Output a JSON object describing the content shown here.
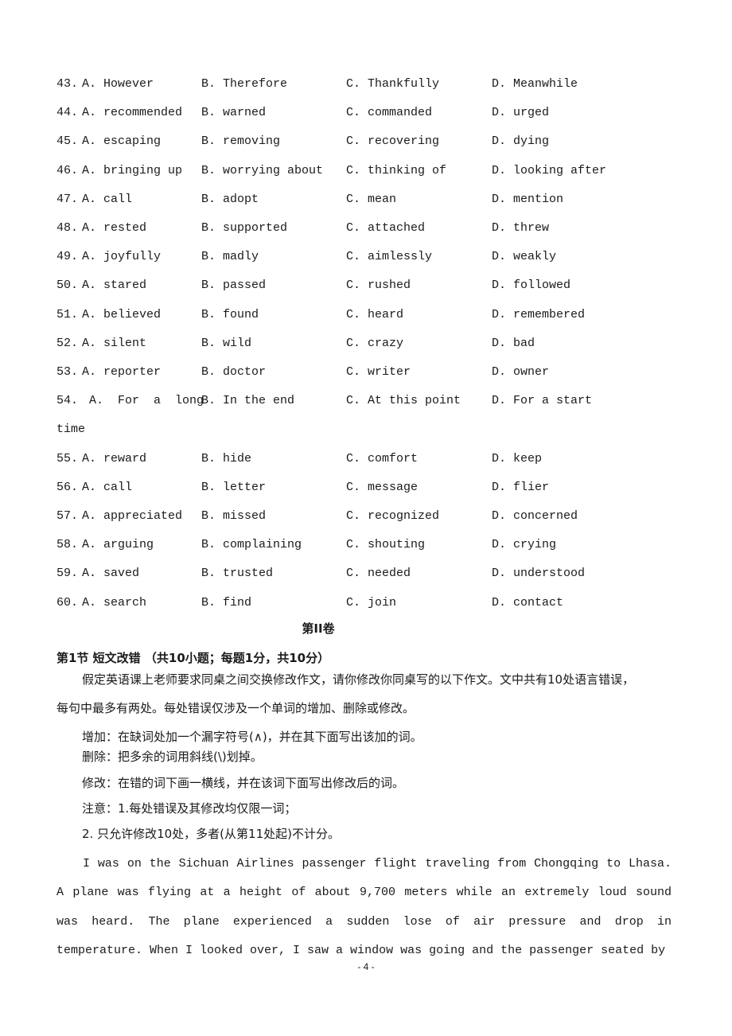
{
  "questions": [
    {
      "num": "43.",
      "a": "A. However",
      "b": "B. Therefore",
      "c": "C. Thankfully",
      "d": "D. Meanwhile"
    },
    {
      "num": "44.",
      "a": "A. recommended",
      "b": "B. warned",
      "c": "C. commanded",
      "d": "D. urged"
    },
    {
      "num": "45.",
      "a": "A. escaping",
      "b": "B. removing",
      "c": "C. recovering",
      "d": "D. dying"
    },
    {
      "num": "46.",
      "a": "A. bringing up",
      "b": "B. worrying about",
      "c": "C. thinking of",
      "d": "D. looking after"
    },
    {
      "num": "47.",
      "a": "A. call",
      "b": "B. adopt",
      "c": "C. mean",
      "d": "D. mention"
    },
    {
      "num": "48.",
      "a": "A. rested",
      "b": "B. supported",
      "c": "C. attached",
      "d": "D. threw"
    },
    {
      "num": "49.",
      "a": "A. joyfully",
      "b": "B. madly",
      "c": "C. aimlessly",
      "d": "D. weakly"
    },
    {
      "num": "50.",
      "a": "A. stared",
      "b": "B. passed",
      "c": "C. rushed",
      "d": "D. followed"
    },
    {
      "num": "51.",
      "a": "A. believed",
      "b": "B. found",
      "c": "C. heard",
      "d": "D. remembered"
    },
    {
      "num": "52.",
      "a": "A. silent",
      "b": "B. wild",
      "c": "C. crazy",
      "d": "D. bad"
    },
    {
      "num": "53.",
      "a": "A. reporter",
      "b": "B. doctor",
      "c": "C. writer",
      "d": "D. owner"
    },
    {
      "num": "54.",
      "a": " A.  For  a  long",
      "b": "B. In the end",
      "c": "C. At this point",
      "d": "D. For a start",
      "wrap": "time"
    },
    {
      "num": "55.",
      "a": "A. reward",
      "b": "B. hide",
      "c": "C. comfort",
      "d": "D. keep"
    },
    {
      "num": "56.",
      "a": "A. call",
      "b": "B. letter",
      "c": "C. message",
      "d": "D. flier"
    },
    {
      "num": "57.",
      "a": "A. appreciated",
      "b": "B. missed",
      "c": "C. recognized",
      "d": "D. concerned"
    },
    {
      "num": "58.",
      "a": "A. arguing",
      "b": "B. complaining",
      "c": "C. shouting",
      "d": "D. crying"
    },
    {
      "num": "59.",
      "a": "A. saved",
      "b": "B. trusted",
      "c": "C. needed",
      "d": "D. understood"
    },
    {
      "num": "60.",
      "a": "A. search",
      "b": "B. find",
      "c": "C. join",
      "d": "D. contact"
    }
  ],
  "volume_title": "第II卷",
  "section": {
    "title": "第1节 短文改错 （共10小题；每题1分，共10分）",
    "instructions": {
      "intro_line1": "假定英语课上老师要求同桌之间交换修改作文，请你修改你同桌写的以下作文。文中共有10处语言错误，",
      "intro_line2": "每句中最多有两处。每处错误仅涉及一个单词的增加、删除或修改。",
      "add": "增加：在缺词处加一个漏字符号(∧)，并在其下面写出该加的词。",
      "delete": "删除：把多余的词用斜线(\\)划掉。",
      "modify": "修改：在错的词下画一横线，并在该词下面写出修改后的词。",
      "note1": "注意：1.每处错误及其修改均仅限一词；",
      "note2": "2. 只允许修改10处，多者(从第11处起)不计分。"
    },
    "passage": "I was on the Sichuan Airlines passenger flight traveling from Chongqing to Lhasa. A plane was flying at a height of about 9,700 meters while an extremely loud sound was heard. The plane experienced a sudden lose of air pressure and drop in temperature. When I looked over, I saw a window was going and the passenger seated by"
  },
  "footer": {
    "page_number": "- 4 -"
  }
}
